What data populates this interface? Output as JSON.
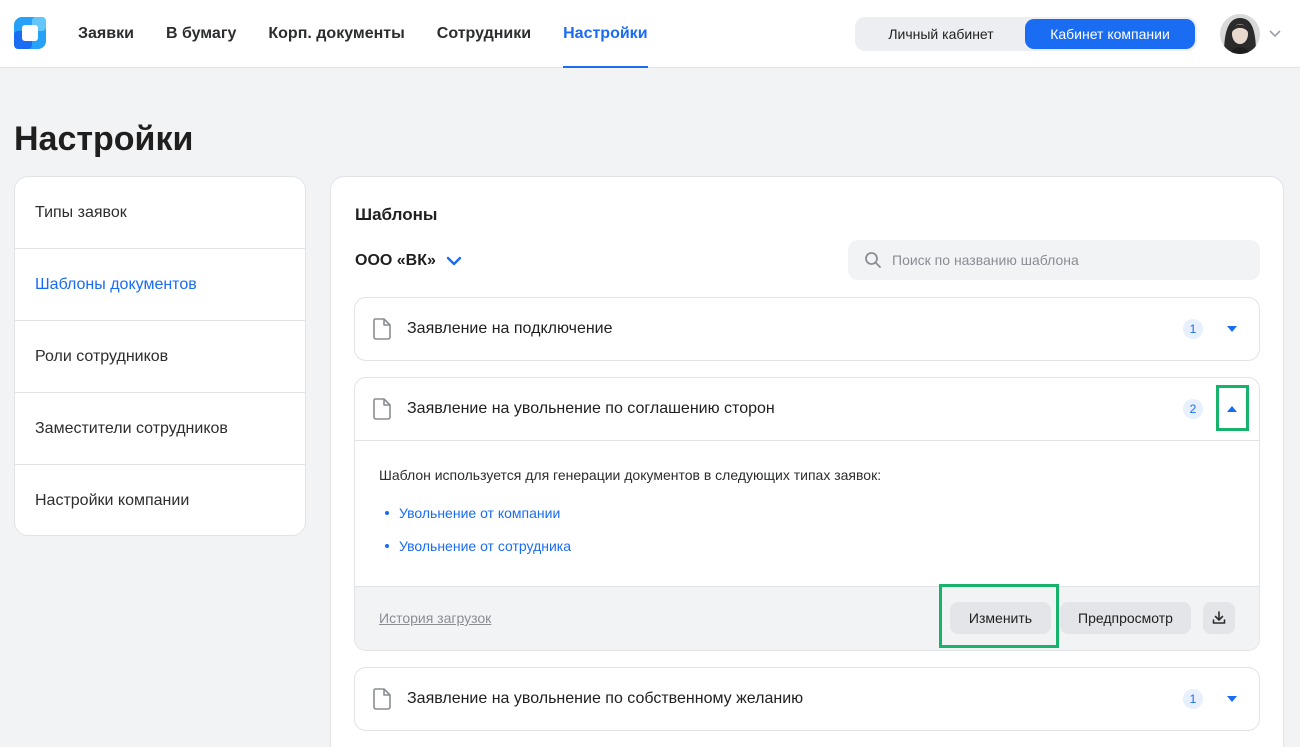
{
  "header": {
    "nav": [
      {
        "label": "Заявки"
      },
      {
        "label": "В бумагу"
      },
      {
        "label": "Корп. документы"
      },
      {
        "label": "Сотрудники"
      },
      {
        "label": "Настройки"
      }
    ],
    "active_nav": "Настройки",
    "switch": {
      "personal": "Личный кабинет",
      "company": "Кабинет компании",
      "active": "company"
    }
  },
  "page": {
    "title": "Настройки"
  },
  "sidebar": {
    "items": [
      {
        "label": "Типы заявок"
      },
      {
        "label": "Шаблоны документов"
      },
      {
        "label": "Роли сотрудников"
      },
      {
        "label": "Заместители сотрудников"
      },
      {
        "label": "Настройки компании"
      }
    ],
    "active": "Шаблоны документов"
  },
  "main": {
    "title": "Шаблоны",
    "org": "ООО «ВК»",
    "search_placeholder": "Поиск по названию шаблона",
    "templates": [
      {
        "name": "Заявление на подключение",
        "count": "1",
        "expanded": false
      },
      {
        "name": "Заявление на увольнение по соглашению сторон",
        "count": "2",
        "expanded": true,
        "description": "Шаблон используется для генерации документов в следующих типах заявок:",
        "types": [
          "Увольнение от компании",
          "Увольнение от сотрудника"
        ],
        "history_label": "История загрузок",
        "edit_label": "Изменить",
        "preview_label": "Предпросмотр"
      },
      {
        "name": "Заявление на увольнение по собственному желанию",
        "count": "1",
        "expanded": false
      }
    ]
  },
  "colors": {
    "accent": "#1a6cf2",
    "highlight": "#18b36b",
    "background": "#f2f3f5"
  },
  "icons": [
    "app-logo-icon",
    "avatar",
    "chevron-down-icon",
    "search-icon",
    "document-icon",
    "triangle-down-icon",
    "triangle-up-icon",
    "download-icon"
  ]
}
